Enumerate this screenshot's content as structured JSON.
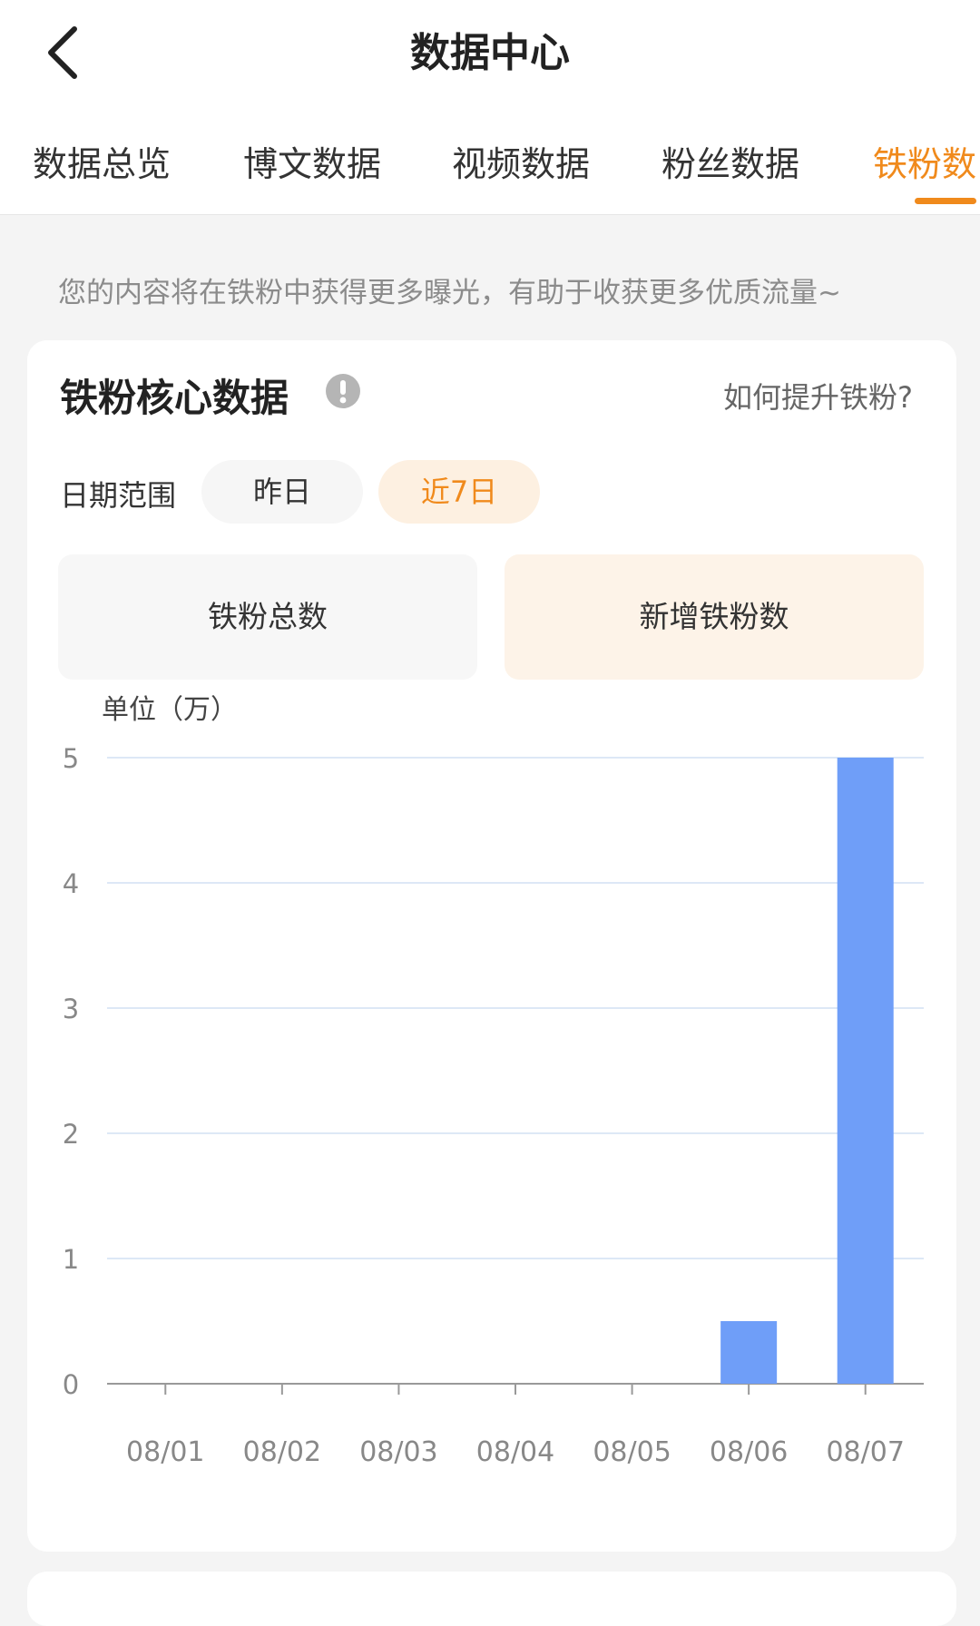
{
  "header": {
    "title": "数据中心"
  },
  "tabs": [
    {
      "label": "数据总览",
      "active": false
    },
    {
      "label": "博文数据",
      "active": false
    },
    {
      "label": "视频数据",
      "active": false
    },
    {
      "label": "粉丝数据",
      "active": false
    },
    {
      "label": "铁粉数",
      "active": true
    }
  ],
  "notice": "您的内容将在铁粉中获得更多曝光，有助于收获更多优质流量~",
  "core": {
    "title": "铁粉核心数据",
    "help_link": "如何提升铁粉?",
    "date_range_label": "日期范围",
    "date_options": [
      {
        "label": "昨日",
        "active": false
      },
      {
        "label": "近7日",
        "active": true
      }
    ],
    "metrics": [
      {
        "label": "铁粉总数",
        "active": false
      },
      {
        "label": "新增铁粉数",
        "active": true
      }
    ]
  },
  "colors": {
    "accent": "#f08a1c",
    "bar": "#6f9ef8",
    "grid": "#dde8f6"
  },
  "icons": {
    "back": "chevron-left-icon",
    "info": "info-icon"
  },
  "chart_data": {
    "type": "bar",
    "unit_label": "单位（万）",
    "categories": [
      "08/01",
      "08/02",
      "08/03",
      "08/04",
      "08/05",
      "08/06",
      "08/07"
    ],
    "values": [
      0,
      0,
      0,
      0,
      0,
      0.5,
      5
    ],
    "y_ticks": [
      0,
      1,
      2,
      3,
      4,
      5
    ],
    "ylim": [
      0,
      5
    ],
    "grid": true
  }
}
